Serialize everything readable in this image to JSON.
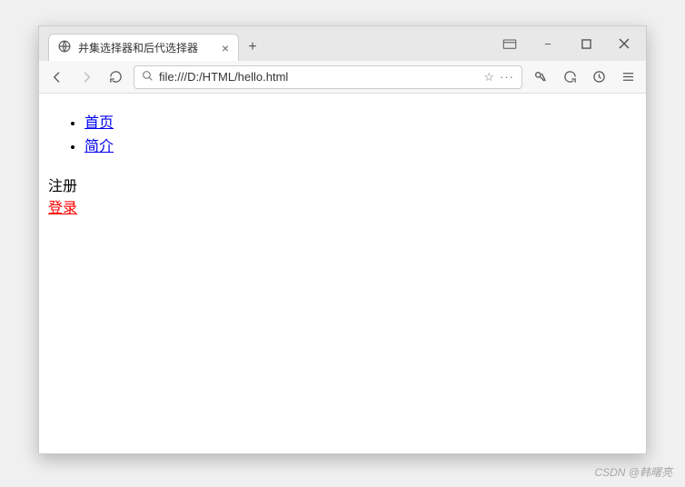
{
  "window": {
    "tab_title": "并集选择器和后代选择器",
    "new_tab_label": "+",
    "close_tab_label": "×"
  },
  "controls": {
    "shirt": "⌄",
    "minimize": "−",
    "maximize": "□",
    "close": "×"
  },
  "nav": {
    "back": "←",
    "forward": "→",
    "reload": "↻",
    "search_icon": "⌕",
    "url": "file:///D:/HTML/hello.html",
    "star": "☆",
    "more": "···",
    "cut": "✂",
    "undo": "↺",
    "history": "◔",
    "menu": "≡"
  },
  "page": {
    "list": [
      "首页",
      "简介"
    ],
    "register": "注册",
    "login": "登录"
  },
  "watermark": "CSDN @韩曙亮"
}
